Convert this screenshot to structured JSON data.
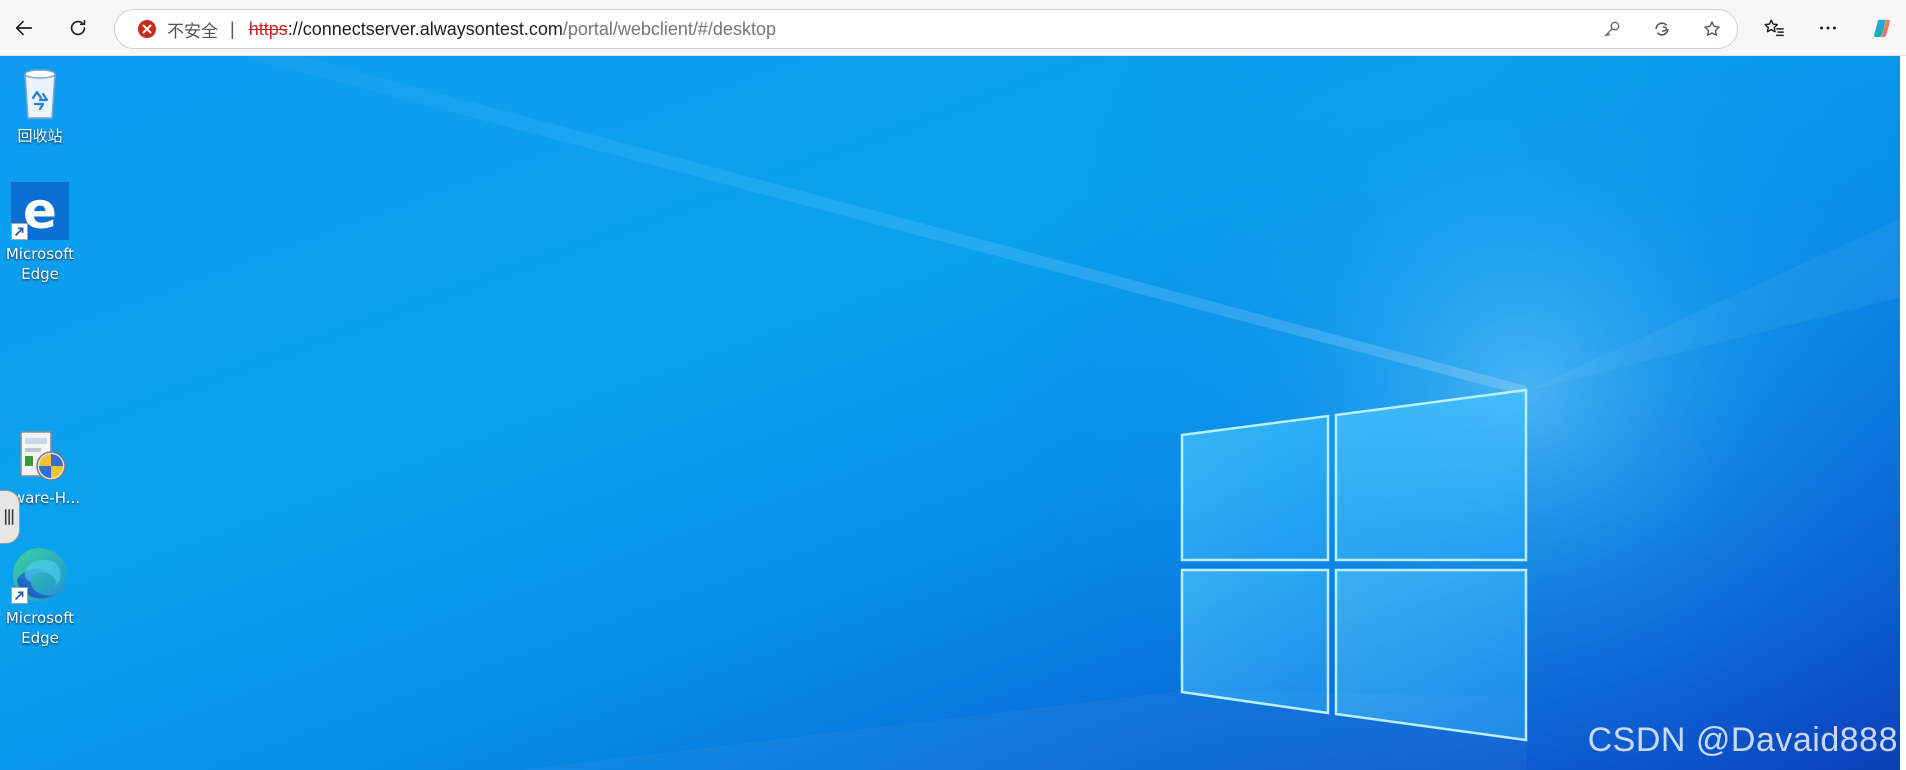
{
  "toolbar": {
    "security_text": "不安全",
    "separator": "|",
    "url_scheme": "https",
    "url_host": "://connectserver.alwaysontest.com",
    "url_path": "/portal/webclient/#/desktop"
  },
  "icons": {
    "back": "back-arrow-icon",
    "refresh": "refresh-icon",
    "security": "not-secure-icon",
    "key": "key-icon",
    "reader": "immersive-reader-icon",
    "favorite": "star-icon",
    "favorites_bar": "favorites-icon",
    "more": "more-icon",
    "copilot": "copilot-icon"
  },
  "colors": {
    "warning_red": "#c42b1c",
    "desktop_blue": "#0aa2ee",
    "desktop_dark_blue": "#0b3fb7"
  },
  "desktop": {
    "items": [
      {
        "label": "回收站",
        "icon": "recycle-bin-icon"
      },
      {
        "label": "Microsoft Edge",
        "icon": "edge-legacy-icon"
      },
      {
        "label": "Mware-H...",
        "icon": "installer-icon"
      },
      {
        "label": "Microsoft Edge",
        "icon": "edge-icon"
      }
    ],
    "watermark": "CSDN @Davaid888"
  }
}
